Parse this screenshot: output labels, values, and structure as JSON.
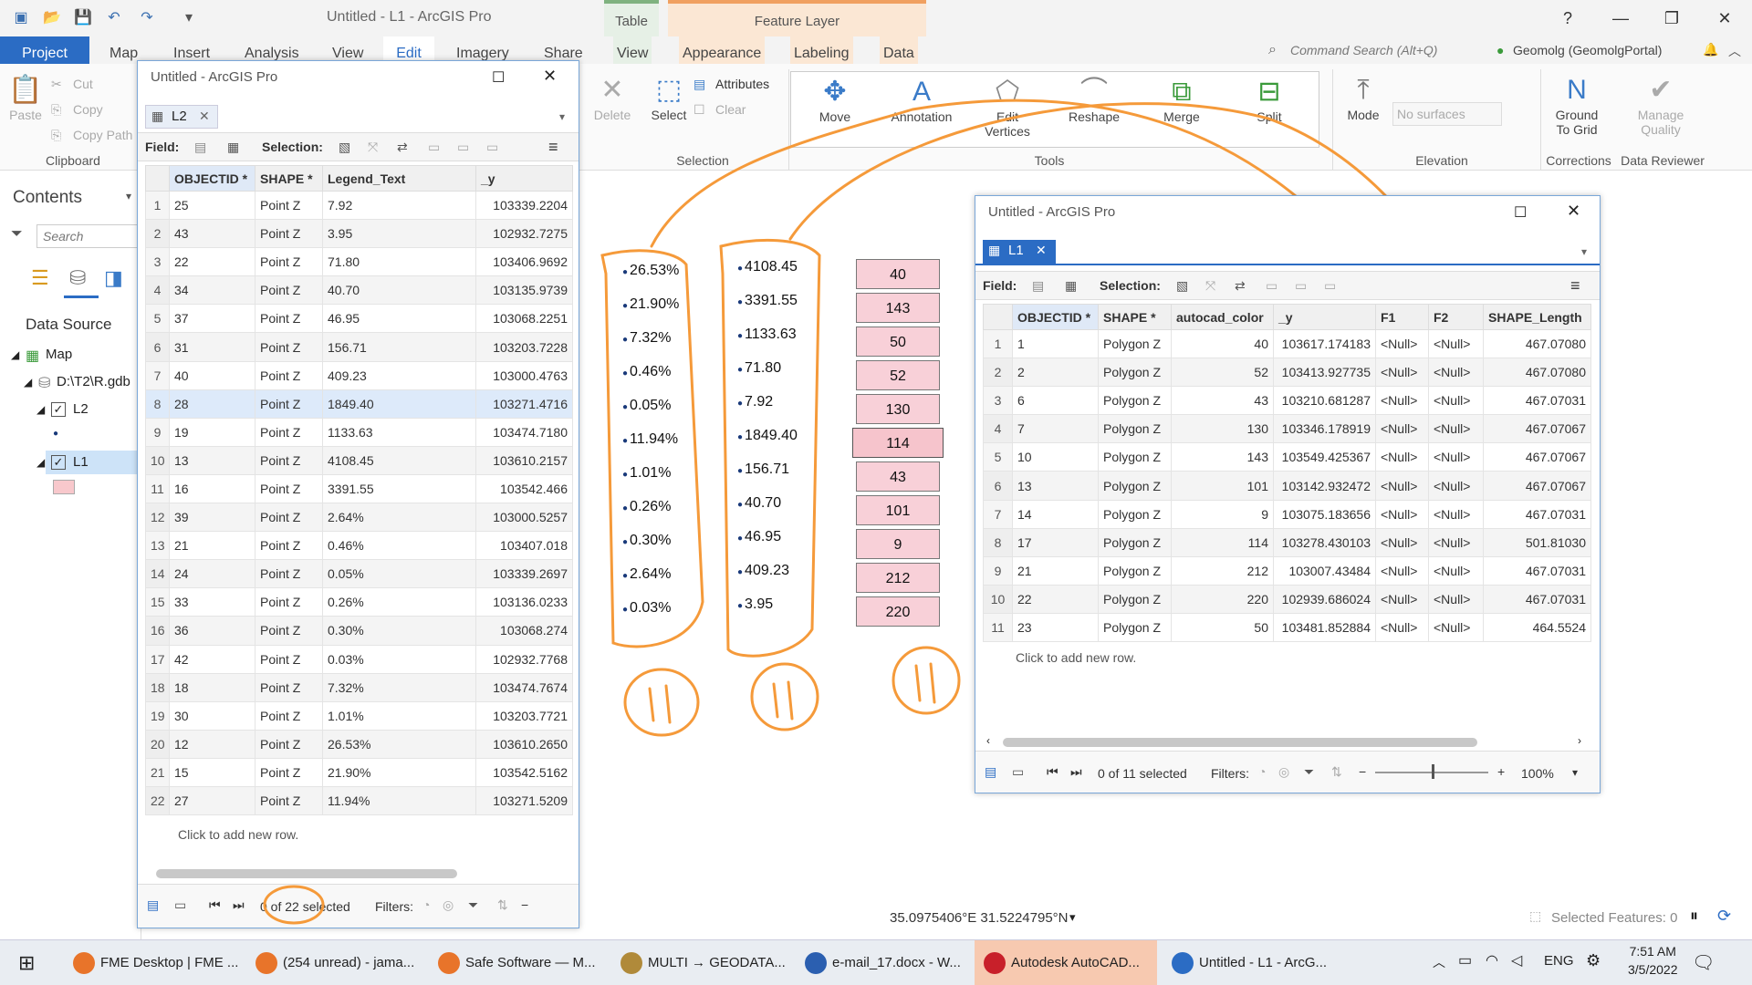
{
  "app": {
    "title": "Untitled - L1 - ArcGIS Pro"
  },
  "context_tabs": {
    "table": "Table",
    "feature_layer": "Feature Layer"
  },
  "ribbon_tabs": [
    "Project",
    "Map",
    "Insert",
    "Analysis",
    "View",
    "Edit",
    "Imagery",
    "Share",
    "View",
    "Appearance",
    "Labeling",
    "Data"
  ],
  "command_search": "Command Search (Alt+Q)",
  "portal": "Geomolg (GeomolgPortal)",
  "ribbon": {
    "clipboard": {
      "paste": "Paste",
      "cut": "Cut",
      "copy": "Copy",
      "copy_path": "Copy Path",
      "label": "Clipboard"
    },
    "delete": "Delete",
    "selection": {
      "select": "Select",
      "attributes": "Attributes",
      "clear": "Clear",
      "label": "Selection"
    },
    "tools": {
      "move": "Move",
      "annotation": "Annotation",
      "edit_vertices": "Edit\nVertices",
      "reshape": "Reshape",
      "merge": "Merge",
      "split": "Split",
      "label": "Tools"
    },
    "elevation": {
      "mode": "Mode",
      "surfaces": "No surfaces",
      "label": "Elevation"
    },
    "corrections": {
      "ground_to_grid": "Ground\nTo Grid",
      "label": "Corrections"
    },
    "data_reviewer": {
      "manage_quality": "Manage\nQuality",
      "label": "Data Reviewer"
    }
  },
  "contents": {
    "title": "Contents",
    "search_placeholder": "Search",
    "data_source": "Data Source",
    "map": "Map",
    "gdb": "D:\\T2\\R.gdb",
    "layer_l2": "L2",
    "layer_l1": "L1"
  },
  "window_l2": {
    "title": "Untitled - ArcGIS Pro",
    "tab": "L2",
    "field_label": "Field:",
    "selection_label": "Selection:",
    "columns": [
      "OBJECTID *",
      "SHAPE *",
      "Legend_Text",
      "_y"
    ],
    "rows": [
      [
        "1",
        "25",
        "Point Z",
        "7.92",
        "103339.2204"
      ],
      [
        "2",
        "43",
        "Point Z",
        "3.95",
        "102932.7275"
      ],
      [
        "3",
        "22",
        "Point Z",
        "71.80",
        "103406.9692"
      ],
      [
        "4",
        "34",
        "Point Z",
        "40.70",
        "103135.9739"
      ],
      [
        "5",
        "37",
        "Point Z",
        "46.95",
        "103068.2251"
      ],
      [
        "6",
        "31",
        "Point Z",
        "156.71",
        "103203.7228"
      ],
      [
        "7",
        "40",
        "Point Z",
        "409.23",
        "103000.4763"
      ],
      [
        "8",
        "28",
        "Point Z",
        "1849.40",
        "103271.4716"
      ],
      [
        "9",
        "19",
        "Point Z",
        "1133.63",
        "103474.7180"
      ],
      [
        "10",
        "13",
        "Point Z",
        "4108.45",
        "103610.2157"
      ],
      [
        "11",
        "16",
        "Point Z",
        "3391.55",
        "103542.466"
      ],
      [
        "12",
        "39",
        "Point Z",
        "2.64%",
        "103000.5257"
      ],
      [
        "13",
        "21",
        "Point Z",
        "0.46%",
        "103407.018"
      ],
      [
        "14",
        "24",
        "Point Z",
        "0.05%",
        "103339.2697"
      ],
      [
        "15",
        "33",
        "Point Z",
        "0.26%",
        "103136.0233"
      ],
      [
        "16",
        "36",
        "Point Z",
        "0.30%",
        "103068.274"
      ],
      [
        "17",
        "42",
        "Point Z",
        "0.03%",
        "102932.7768"
      ],
      [
        "18",
        "18",
        "Point Z",
        "7.32%",
        "103474.7674"
      ],
      [
        "19",
        "30",
        "Point Z",
        "1.01%",
        "103203.7721"
      ],
      [
        "20",
        "12",
        "Point Z",
        "26.53%",
        "103610.2650"
      ],
      [
        "21",
        "15",
        "Point Z",
        "21.90%",
        "103542.5162"
      ],
      [
        "22",
        "27",
        "Point Z",
        "11.94%",
        "103271.5209"
      ]
    ],
    "add_row": "Click to add new row.",
    "status": "0 of 22 selected",
    "filters": "Filters:"
  },
  "window_l1": {
    "title": "Untitled - ArcGIS Pro",
    "tab": "L1",
    "field_label": "Field:",
    "selection_label": "Selection:",
    "columns": [
      "OBJECTID *",
      "SHAPE *",
      "autocad_color",
      "_y",
      "F1",
      "F2",
      "SHAPE_Length"
    ],
    "rows": [
      [
        "1",
        "1",
        "Polygon Z",
        "40",
        "103617.174183",
        "<Null>",
        "<Null>",
        "467.07080"
      ],
      [
        "2",
        "2",
        "Polygon Z",
        "52",
        "103413.927735",
        "<Null>",
        "<Null>",
        "467.07080"
      ],
      [
        "3",
        "6",
        "Polygon Z",
        "43",
        "103210.681287",
        "<Null>",
        "<Null>",
        "467.07031"
      ],
      [
        "4",
        "7",
        "Polygon Z",
        "130",
        "103346.178919",
        "<Null>",
        "<Null>",
        "467.07067"
      ],
      [
        "5",
        "10",
        "Polygon Z",
        "143",
        "103549.425367",
        "<Null>",
        "<Null>",
        "467.07067"
      ],
      [
        "6",
        "13",
        "Polygon Z",
        "101",
        "103142.932472",
        "<Null>",
        "<Null>",
        "467.07067"
      ],
      [
        "7",
        "14",
        "Polygon Z",
        "9",
        "103075.183656",
        "<Null>",
        "<Null>",
        "467.07031"
      ],
      [
        "8",
        "17",
        "Polygon Z",
        "114",
        "103278.430103",
        "<Null>",
        "<Null>",
        "501.81030"
      ],
      [
        "9",
        "21",
        "Polygon Z",
        "212",
        "103007.43484",
        "<Null>",
        "<Null>",
        "467.07031"
      ],
      [
        "10",
        "22",
        "Polygon Z",
        "220",
        "102939.686024",
        "<Null>",
        "<Null>",
        "467.07031"
      ],
      [
        "11",
        "23",
        "Polygon Z",
        "50",
        "103481.852884",
        "<Null>",
        "<Null>",
        "464.5524"
      ]
    ],
    "add_row": "Click to add new row.",
    "status": "0 of 11 selected",
    "filters": "Filters:",
    "zoom": "100%"
  },
  "annotations": {
    "percents": [
      "26.53%",
      "21.90%",
      "7.32%",
      "0.46%",
      "0.05%",
      "11.94%",
      "1.01%",
      "0.26%",
      "0.30%",
      "2.64%",
      "0.03%"
    ],
    "values": [
      "4108.45",
      "3391.55",
      "1133.63",
      "71.80",
      "7.92",
      "1849.40",
      "156.71",
      "40.70",
      "46.95",
      "409.23",
      "3.95"
    ],
    "colors": [
      "40",
      "143",
      "50",
      "52",
      "130",
      "114",
      "43",
      "101",
      "9",
      "212",
      "220"
    ]
  },
  "statusbar": {
    "coords": "35.0975406°E 31.5224795°N",
    "selected_features": "Selected Features: 0"
  },
  "taskbar": {
    "items": [
      "FME Desktop | FME ...",
      "(254 unread) - jama...",
      "Safe Software — M...",
      "MULTI → GEODATA...",
      "e-mail_17.docx - W...",
      "Autodesk AutoCAD...",
      "Untitled - L1 - ArcG..."
    ],
    "lang": "ENG",
    "time": "7:51 AM",
    "date": "3/5/2022"
  },
  "colors": {
    "accent": "#2b6cc4",
    "annotation": "#f59a3a",
    "pink": "#f8d0d8"
  }
}
